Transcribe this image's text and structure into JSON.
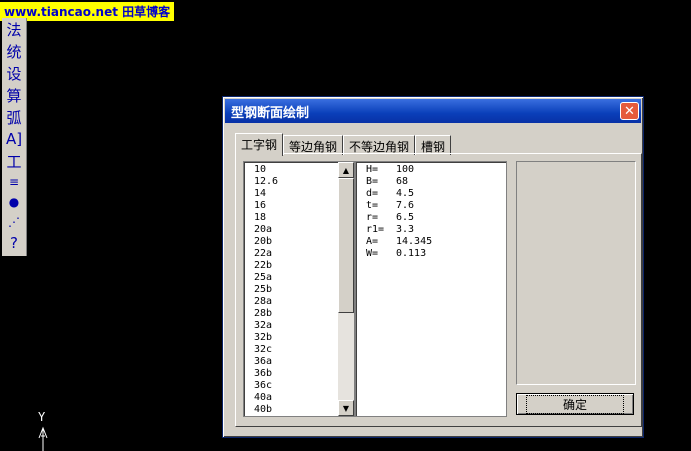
{
  "watermark": {
    "text": "www.tiancao.net 田草博客"
  },
  "toolbar": {
    "items": [
      {
        "label": "法"
      },
      {
        "label": "统"
      },
      {
        "label": "设"
      },
      {
        "label": "算"
      },
      {
        "label": "弧"
      },
      {
        "label": "A]"
      },
      {
        "label": "工"
      },
      {
        "label": "≡"
      },
      {
        "label": "●"
      },
      {
        "label": "⋰"
      },
      {
        "label": "?"
      }
    ]
  },
  "axis": {
    "y_label": "Y"
  },
  "dialog": {
    "title": "型钢断面绘制",
    "close_label": "✕",
    "tabs": [
      {
        "label": "工字钢"
      },
      {
        "label": "等边角钢"
      },
      {
        "label": "不等边角钢"
      },
      {
        "label": "槽钢"
      }
    ],
    "list_items": [
      "10",
      "12.6",
      "14",
      "16",
      "18",
      "20a",
      "20b",
      "22a",
      "22b",
      "25a",
      "25b",
      "28a",
      "28b",
      "32a",
      "32b",
      "32c",
      "36a",
      "36b",
      "36c",
      "40a",
      "40b"
    ],
    "scroll": {
      "up": "▲",
      "down": "▼"
    },
    "properties": [
      {
        "key": "H=",
        "value": "100"
      },
      {
        "key": "B=",
        "value": "68"
      },
      {
        "key": "d=",
        "value": "4.5"
      },
      {
        "key": "t=",
        "value": "7.6"
      },
      {
        "key": "r=",
        "value": "6.5"
      },
      {
        "key": "r1=",
        "value": "3.3"
      },
      {
        "key": "A=",
        "value": "14.345"
      },
      {
        "key": "W=",
        "value": "0.113"
      }
    ],
    "ok_label": "确定"
  }
}
